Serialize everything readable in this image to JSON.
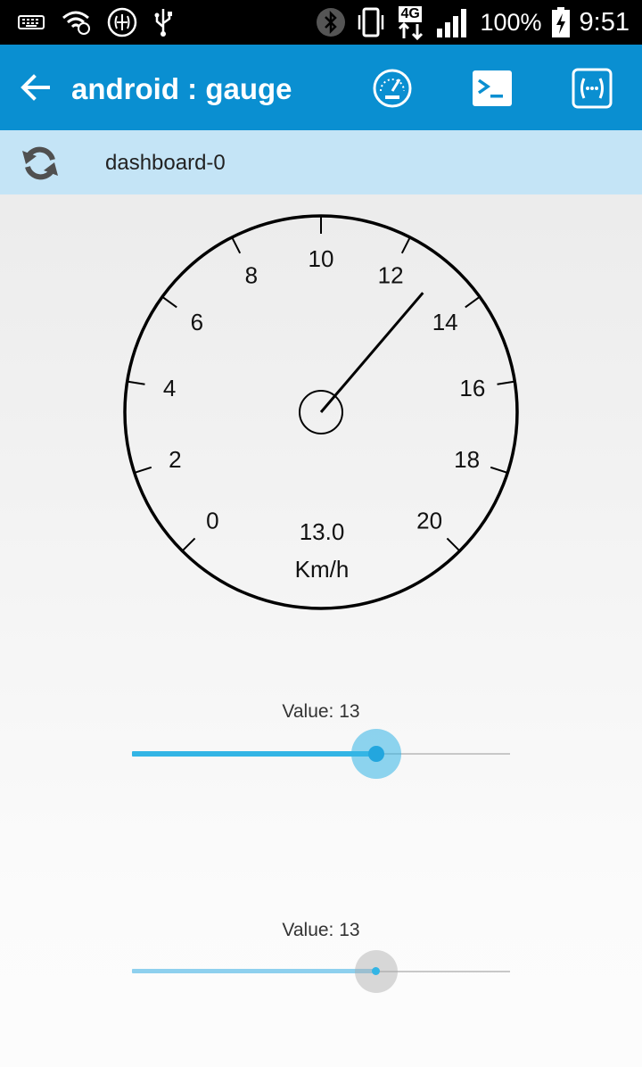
{
  "status_bar": {
    "battery_percent": "100%",
    "time": "9:51",
    "network_type": "4G",
    "icons": [
      "keyboard-icon",
      "wifi-icon",
      "brain-app-icon",
      "usb-icon",
      "bluetooth-icon",
      "vibrate-icon",
      "mobile-data-icon",
      "signal-icon",
      "battery-charging-icon"
    ]
  },
  "app_bar": {
    "title": "android : gauge",
    "back_icon": "arrow-left-icon",
    "actions": [
      "speedometer-icon",
      "terminal-icon",
      "mqtt-brackets-icon"
    ],
    "color": "#0a8fd1"
  },
  "sub_bar": {
    "label": "dashboard-0",
    "refresh_icon": "refresh-icon",
    "color": "#c4e4f6"
  },
  "gauge": {
    "min": 0,
    "max": 20,
    "tick_labels": [
      "0",
      "2",
      "4",
      "6",
      "8",
      "10",
      "12",
      "14",
      "16",
      "18",
      "20"
    ],
    "value": 13.0,
    "value_text": "13.0",
    "unit": "Km/h"
  },
  "sliders": [
    {
      "label": "Value: 13",
      "value": 13,
      "min": 0,
      "max": 20,
      "accent": "#33b5e5"
    },
    {
      "label": "Value:  13",
      "value": 13,
      "min": 0,
      "max": 20,
      "accent": "#8ed0ee"
    }
  ]
}
